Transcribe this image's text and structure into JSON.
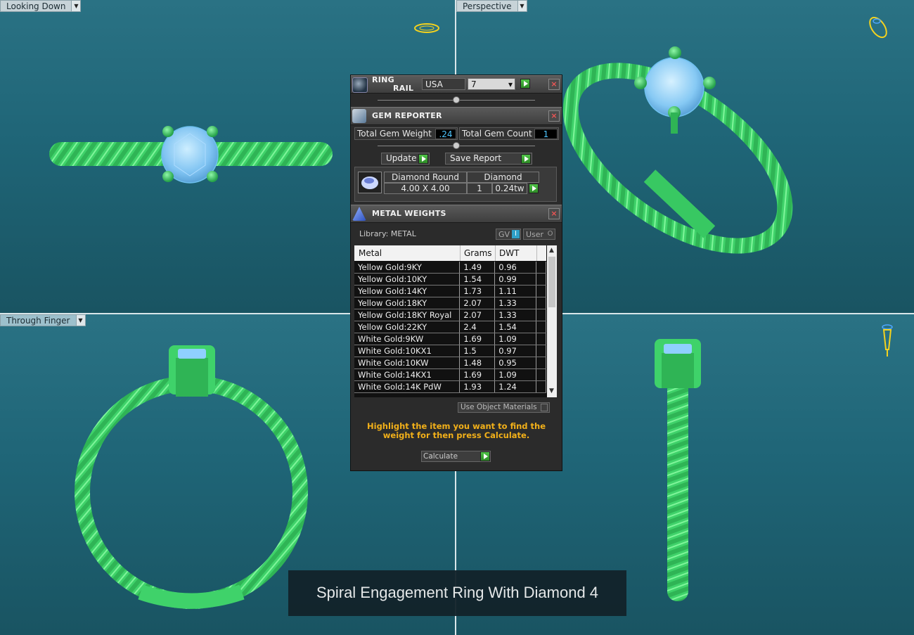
{
  "viewports": {
    "top_left": {
      "label": "Looking Down"
    },
    "top_right": {
      "label": "Perspective"
    },
    "bottom_left": {
      "label": "Through Finger"
    },
    "bottom_right": {
      "label": ""
    }
  },
  "ring_rail": {
    "title_line1": "RING",
    "title_line2": "RAIL",
    "size_system": "USA",
    "size_value": "7",
    "size_dropdown_arrow": "▾"
  },
  "gem_reporter": {
    "title": "GEM REPORTER",
    "total_weight_label": "Total Gem Weight",
    "total_weight_value": ".24",
    "total_count_label": "Total Gem Count",
    "total_count_value": "1",
    "update_label": "Update",
    "save_report_label": "Save Report",
    "gem": {
      "shape": "Diamond Round",
      "size": "4.00 X 4.00",
      "type": "Diamond",
      "count": "1",
      "weight": "0.24tw"
    }
  },
  "metal_weights": {
    "title": "METAL WEIGHTS",
    "library_label": "Library: METAL",
    "gv_label": "GV",
    "gv_indicator": "I",
    "user_label": "User",
    "user_indicator": "O",
    "columns": [
      "Metal",
      "Grams",
      "DWT"
    ],
    "rows": [
      {
        "metal": "Yellow Gold:9KY",
        "grams": "1.49",
        "dwt": "0.96"
      },
      {
        "metal": "Yellow Gold:10KY",
        "grams": "1.54",
        "dwt": "0.99"
      },
      {
        "metal": "Yellow Gold:14KY",
        "grams": "1.73",
        "dwt": "1.11"
      },
      {
        "metal": "Yellow Gold:18KY",
        "grams": "2.07",
        "dwt": "1.33"
      },
      {
        "metal": "Yellow Gold:18KY Royal",
        "grams": "2.07",
        "dwt": "1.33"
      },
      {
        "metal": "Yellow Gold:22KY",
        "grams": "2.4",
        "dwt": "1.54"
      },
      {
        "metal": "White Gold:9KW",
        "grams": "1.69",
        "dwt": "1.09"
      },
      {
        "metal": "White Gold:10KX1",
        "grams": "1.5",
        "dwt": "0.97"
      },
      {
        "metal": "White Gold:10KW",
        "grams": "1.48",
        "dwt": "0.95"
      },
      {
        "metal": "White Gold:14KX1",
        "grams": "1.69",
        "dwt": "1.09"
      },
      {
        "metal": "White Gold:14K PdW",
        "grams": "1.93",
        "dwt": "1.24"
      }
    ],
    "use_object_materials_label": "Use Object Materials",
    "instruction": "Highlight the item you want to find the weight for then press Calculate.",
    "calculate_label": "Calculate"
  },
  "caption": "Spiral Engagement Ring With Diamond 4",
  "colors": {
    "ring_green": "#3fd26a",
    "gem_blue": "#8fd0ff",
    "panel_bg": "#2b2b2b",
    "highlight_text": "#f2b019"
  }
}
